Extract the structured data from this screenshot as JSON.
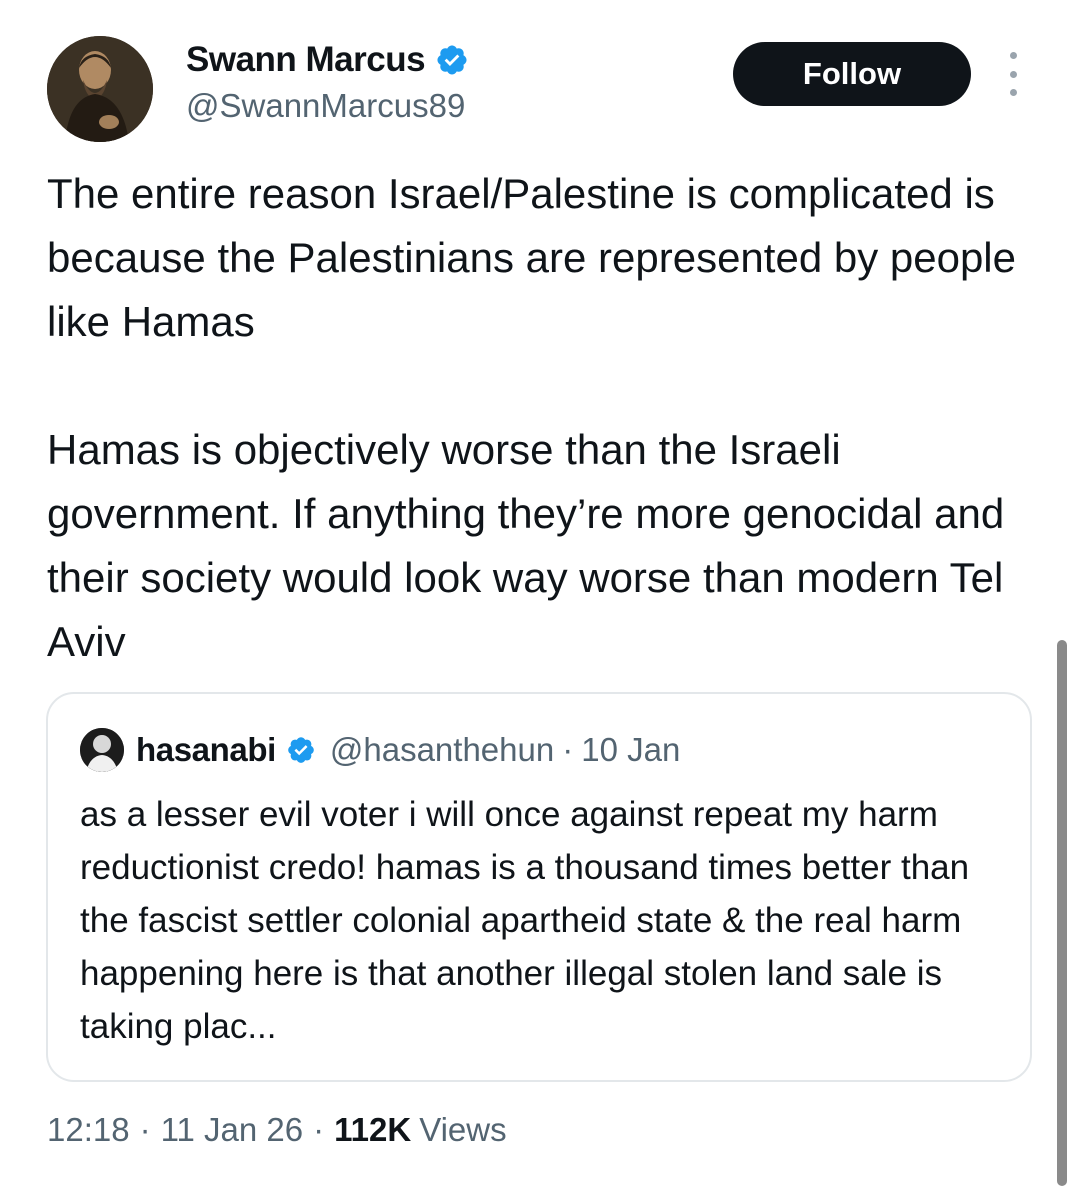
{
  "author": {
    "display_name": "Swann Marcus",
    "handle": "@SwannMarcus89",
    "avatar_icon": "portrait-avatar",
    "verified_icon": "verified-badge-icon"
  },
  "actions": {
    "follow_label": "Follow",
    "more_icon": "more-vertical-icon"
  },
  "tweet": {
    "paragraphs": [
      "The entire reason Israel/Palestine is complicated is because the Palestinians are represented by people like Hamas",
      "Hamas is objectively worse than the Israeli government. If anything they’re more genocidal and their society would look way worse than modern Tel Aviv"
    ]
  },
  "quote": {
    "display_name": "hasanabi",
    "handle": "@hasanthehun",
    "dot": "·",
    "date": "10 Jan",
    "text": "as a lesser evil voter i will once against repeat my harm reductionist credo! hamas is a thousand times better than the fascist settler colonial apartheid state & the real harm happening here is that another illegal stolen land sale is taking plac..."
  },
  "meta": {
    "time": "12:18",
    "sep1": "·",
    "date": "11 Jan 26",
    "sep2": "·",
    "views_count": "112K",
    "views_label": "Views"
  },
  "colors": {
    "text_primary": "#0f1419",
    "text_secondary": "#536471",
    "verified_blue": "#1d9bf0",
    "follow_bg": "#0f1419",
    "border": "#e3e7ea"
  }
}
